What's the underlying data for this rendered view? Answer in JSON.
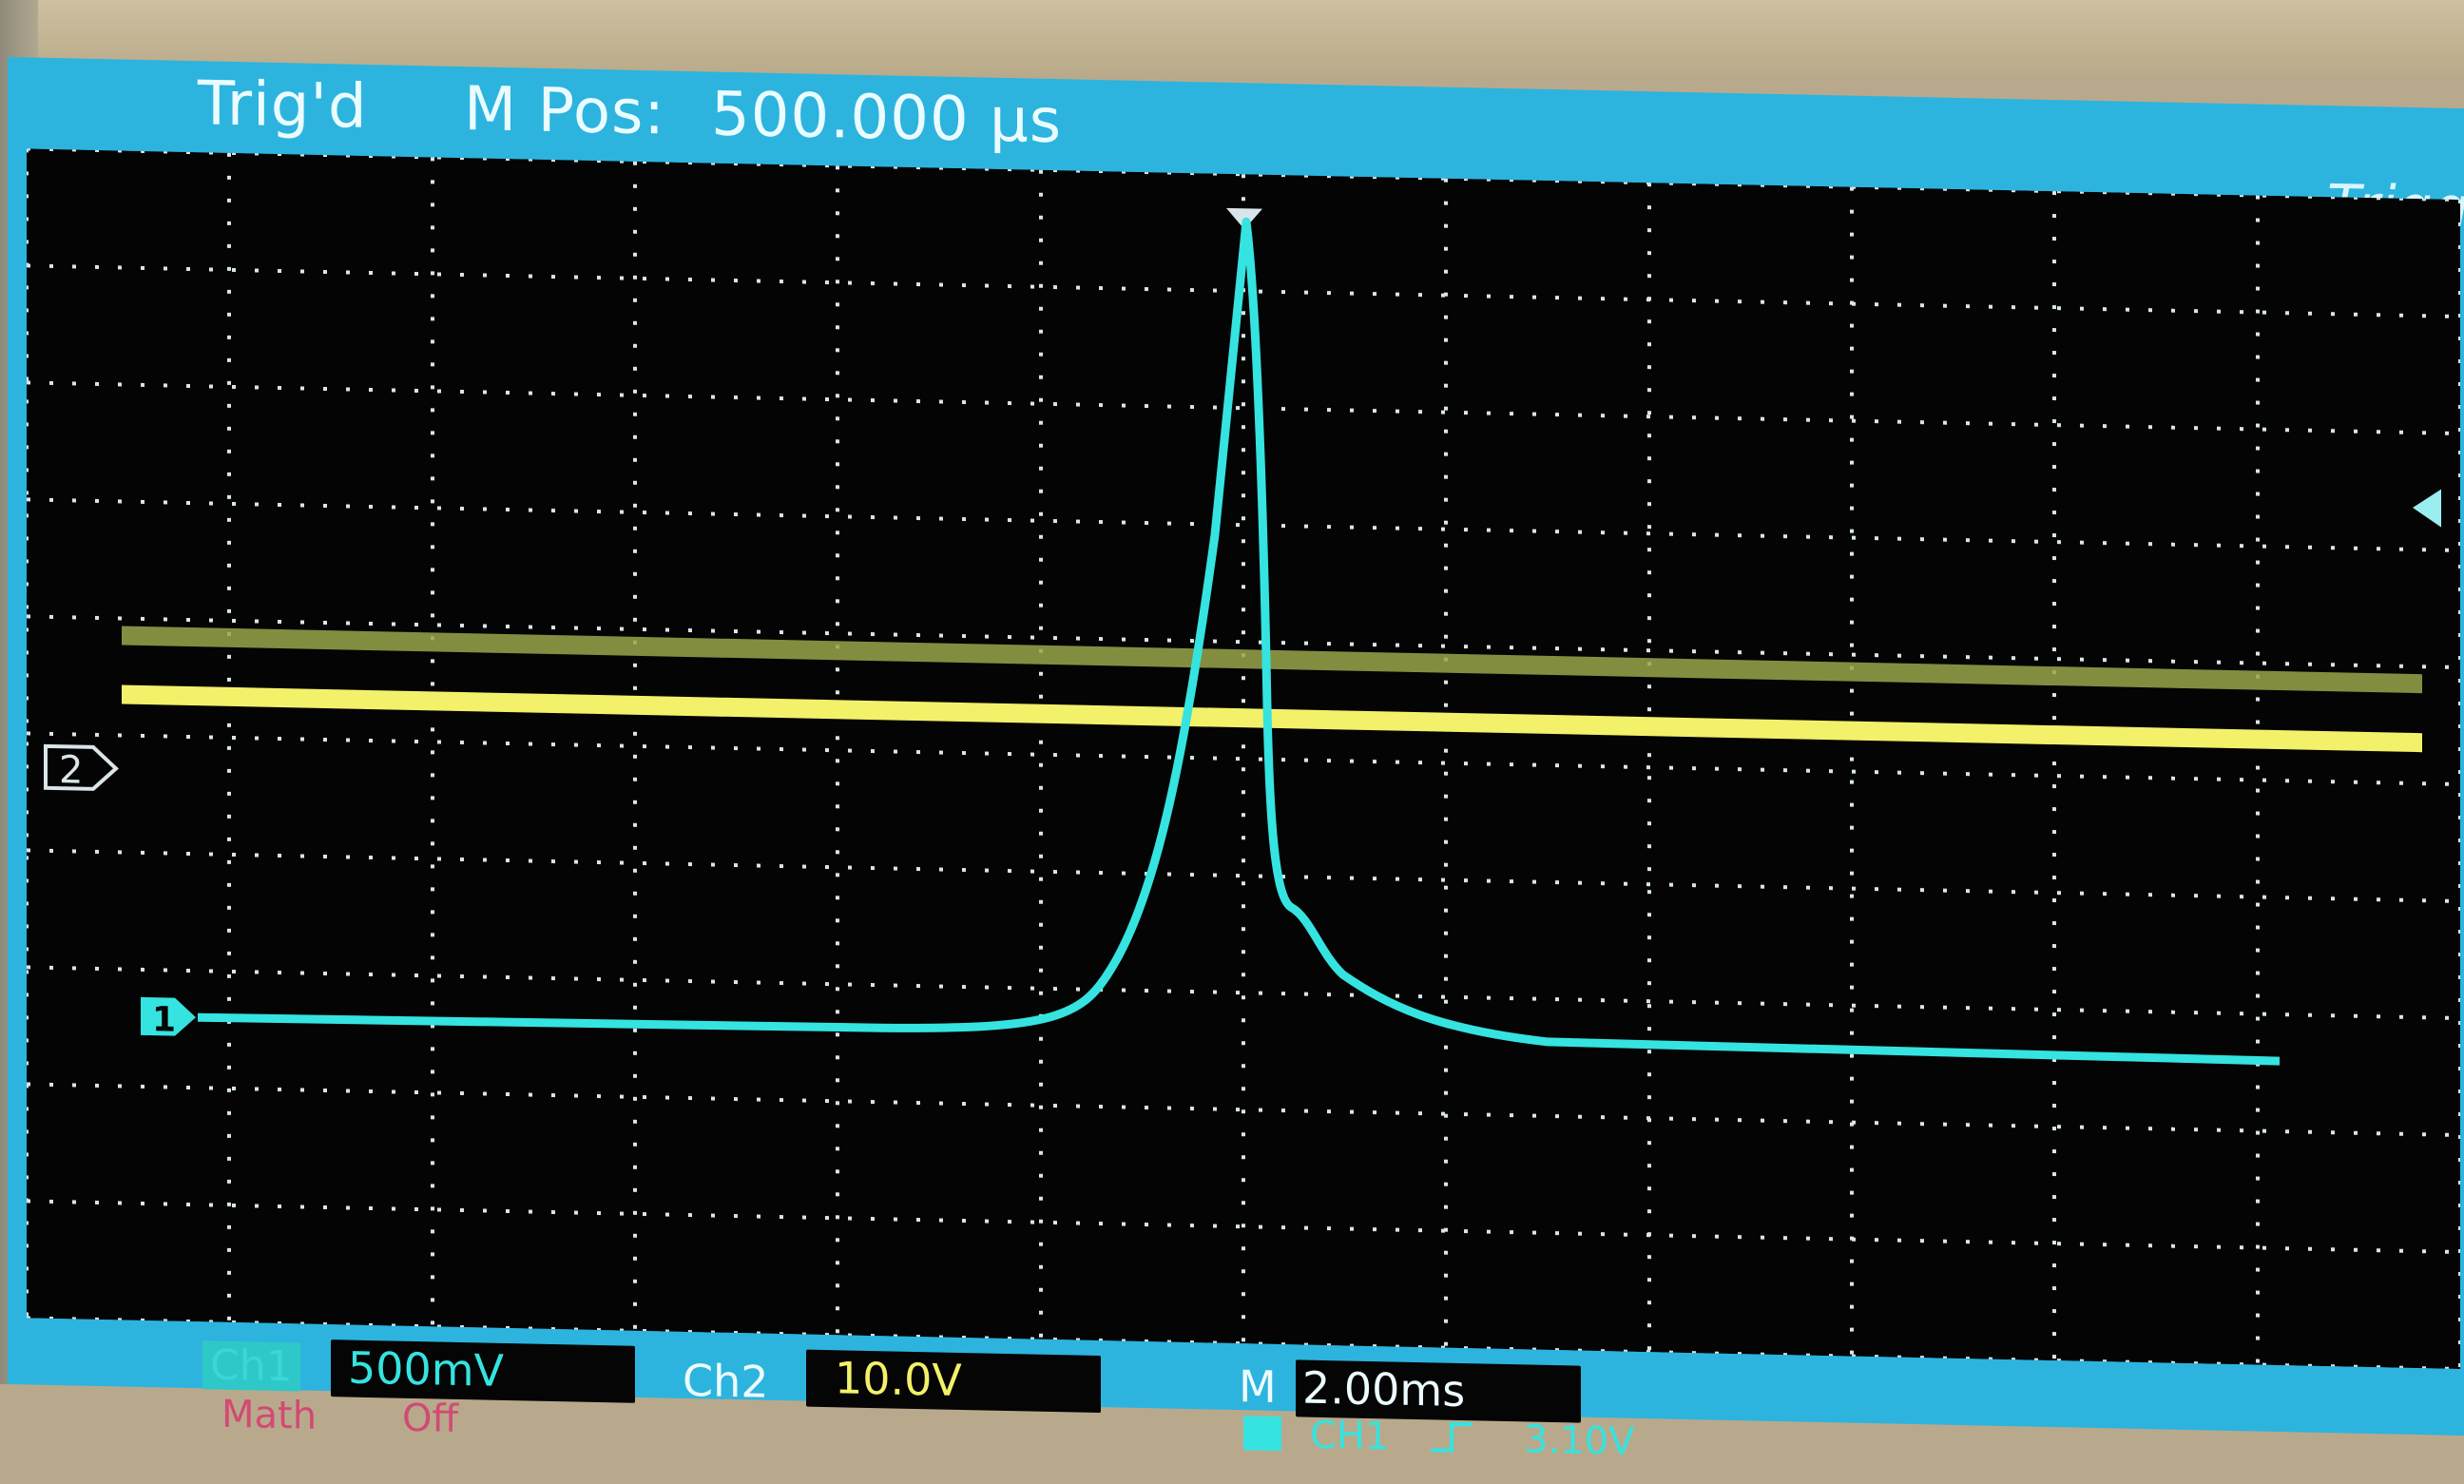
{
  "status": {
    "trigger_state": "Trig'd",
    "m_pos_label": "M Pos:",
    "m_pos_value": "500.000 μs",
    "menu_title": "Trigge"
  },
  "channels": {
    "ch1": {
      "label": "Ch1",
      "scale": "500mV",
      "color": "#35e3e0"
    },
    "ch2": {
      "label": "Ch2",
      "scale": "10.0V",
      "color": "#f3f06a"
    }
  },
  "timebase": {
    "label": "M",
    "value": "2.00ms"
  },
  "math": {
    "label": "Math",
    "state": "Off"
  },
  "trigger_info": {
    "source": "CH1",
    "slope_icon": "rising-edge-icon",
    "level": "3.10V"
  },
  "markers": {
    "ch2_ground": "2",
    "ch1_ground": "1"
  },
  "colors": {
    "screen_bg": "#2cb4de",
    "grid_bg": "#040404",
    "grid_dots": "#d9e5ea",
    "ch2_trace_olive": "#9aa64a"
  }
}
